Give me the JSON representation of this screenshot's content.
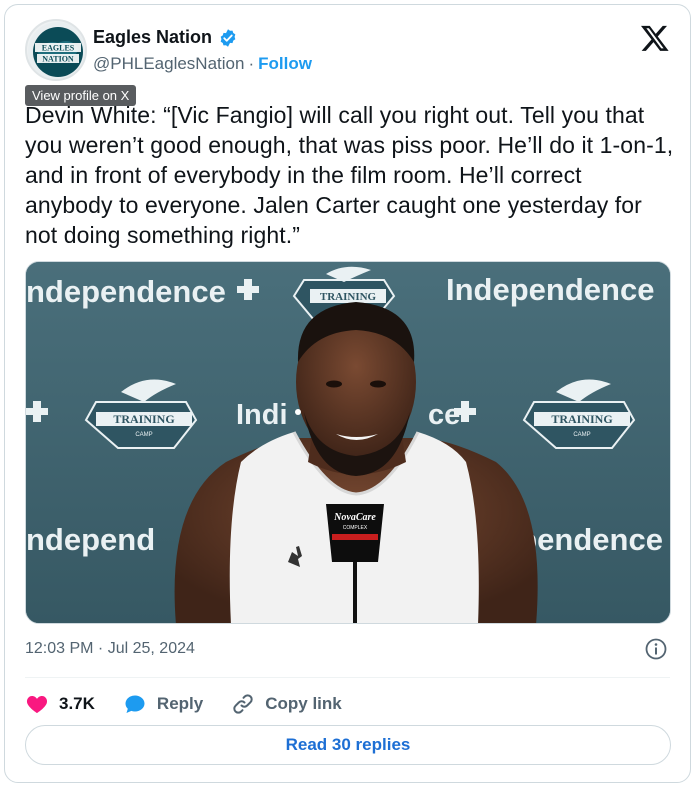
{
  "header": {
    "display_name": "Eagles Nation",
    "handle": "@PHLEaglesNation",
    "separator": "·",
    "follow_label": "Follow",
    "tooltip": "View profile on X"
  },
  "avatar_text": {
    "top": "EAGLES",
    "bottom": "NATION"
  },
  "tweet": {
    "text": "Devin White: “[Vic Fangio] will call you right out. Tell you that you weren’t good enough, that was piss poor. He’ll do it 1-on-1, and in front of everybody in the film room. He’ll correct anybody to everyone. Jalen Carter caught one yesterday for not doing something right.”"
  },
  "media": {
    "backdrop_text": {
      "independence_1": "ndependence",
      "independence_2": "Independence",
      "independence_3": "Indi",
      "independence_3b": "ce",
      "independence_4": "ndepend",
      "independence_5": "ependence",
      "training": "TRAINING",
      "camp": "CAMP",
      "mic_brand": "NovaCare",
      "mic_sub": "COMPLEX"
    }
  },
  "meta": {
    "timestamp": "12:03 PM · Jul 25, 2024"
  },
  "actions": {
    "likes_count": "3.7K",
    "reply_label": "Reply",
    "copy_link_label": "Copy link"
  },
  "replies_button": "Read 30 replies",
  "colors": {
    "accent": "#1d9bf0",
    "heart": "#f91880",
    "reply_bubble": "#1d9bf0",
    "text_secondary": "#536471",
    "backdrop": "#3f6571"
  }
}
